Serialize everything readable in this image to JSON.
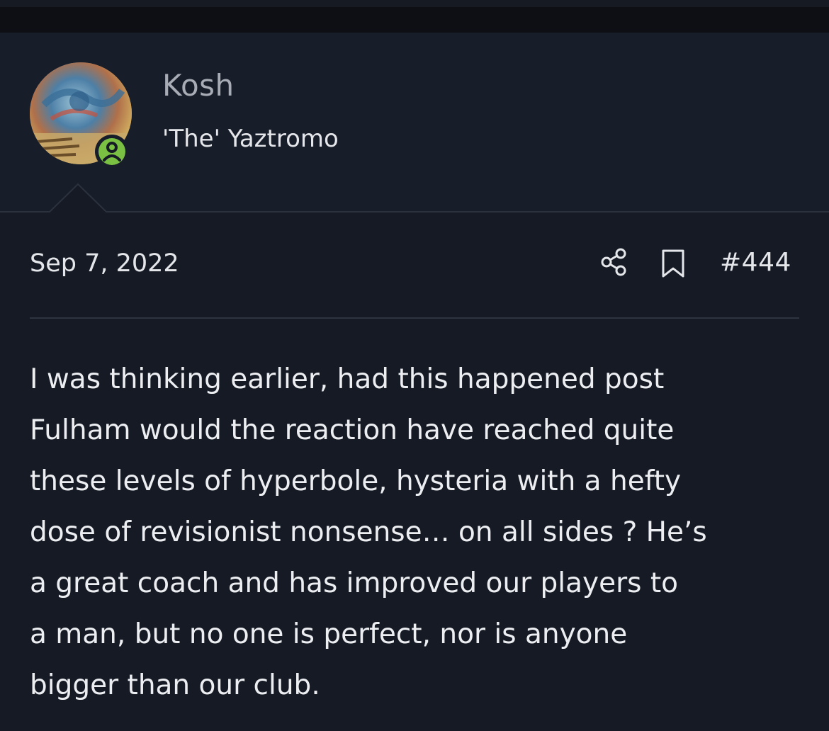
{
  "colors": {
    "background": "#151a25",
    "author_block": "#181d2a",
    "online_status": "#7ac043",
    "name_text": "#a7acb5",
    "body_text": "#eceef1"
  },
  "author": {
    "name": "Kosh",
    "user_title": "'The' Yaztromo",
    "avatar_icon": "avatar-image",
    "status_icon": "online-status-icon"
  },
  "post": {
    "date": "Sep 7, 2022",
    "number": "#444",
    "share_icon": "share-icon",
    "bookmark_icon": "bookmark-icon",
    "body": "I was thinking earlier, had this happened post\nFulham would the reaction have reached quite\nthese levels of hyperbole, hysteria with a hefty\ndose of revisionist nonsense… on all sides ? He’s\na great coach and has improved our players to\na man, but no one is perfect, nor is anyone\nbigger than our club."
  }
}
